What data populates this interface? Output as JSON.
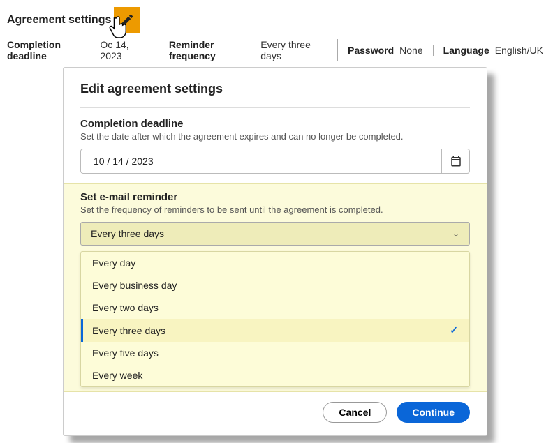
{
  "header": {
    "title": "Agreement settings"
  },
  "meta": {
    "deadline_label": "Completion deadline",
    "deadline_value": "October 14, 2023",
    "deadline_value_obscured": "Oc       14, 2023",
    "reminder_label": "Reminder frequency",
    "reminder_value": "Every three days",
    "password_label": "Password",
    "password_value": "None",
    "language_label": "Language",
    "language_value": "English/UK"
  },
  "dialog": {
    "title": "Edit agreement settings",
    "deadline": {
      "heading": "Completion deadline",
      "sub": "Set the date after which the agreement expires and can no longer be completed.",
      "value": "10 / 14 / 2023"
    },
    "reminder": {
      "heading": "Set e-mail reminder",
      "sub": "Set the frequency of reminders to be sent until the agreement is completed.",
      "selected": "Every three days",
      "options": [
        "Every day",
        "Every business day",
        "Every two days",
        "Every three days",
        "Every five days",
        "Every week"
      ],
      "selected_index": 3
    },
    "buttons": {
      "cancel": "Cancel",
      "continue": "Continue"
    }
  }
}
